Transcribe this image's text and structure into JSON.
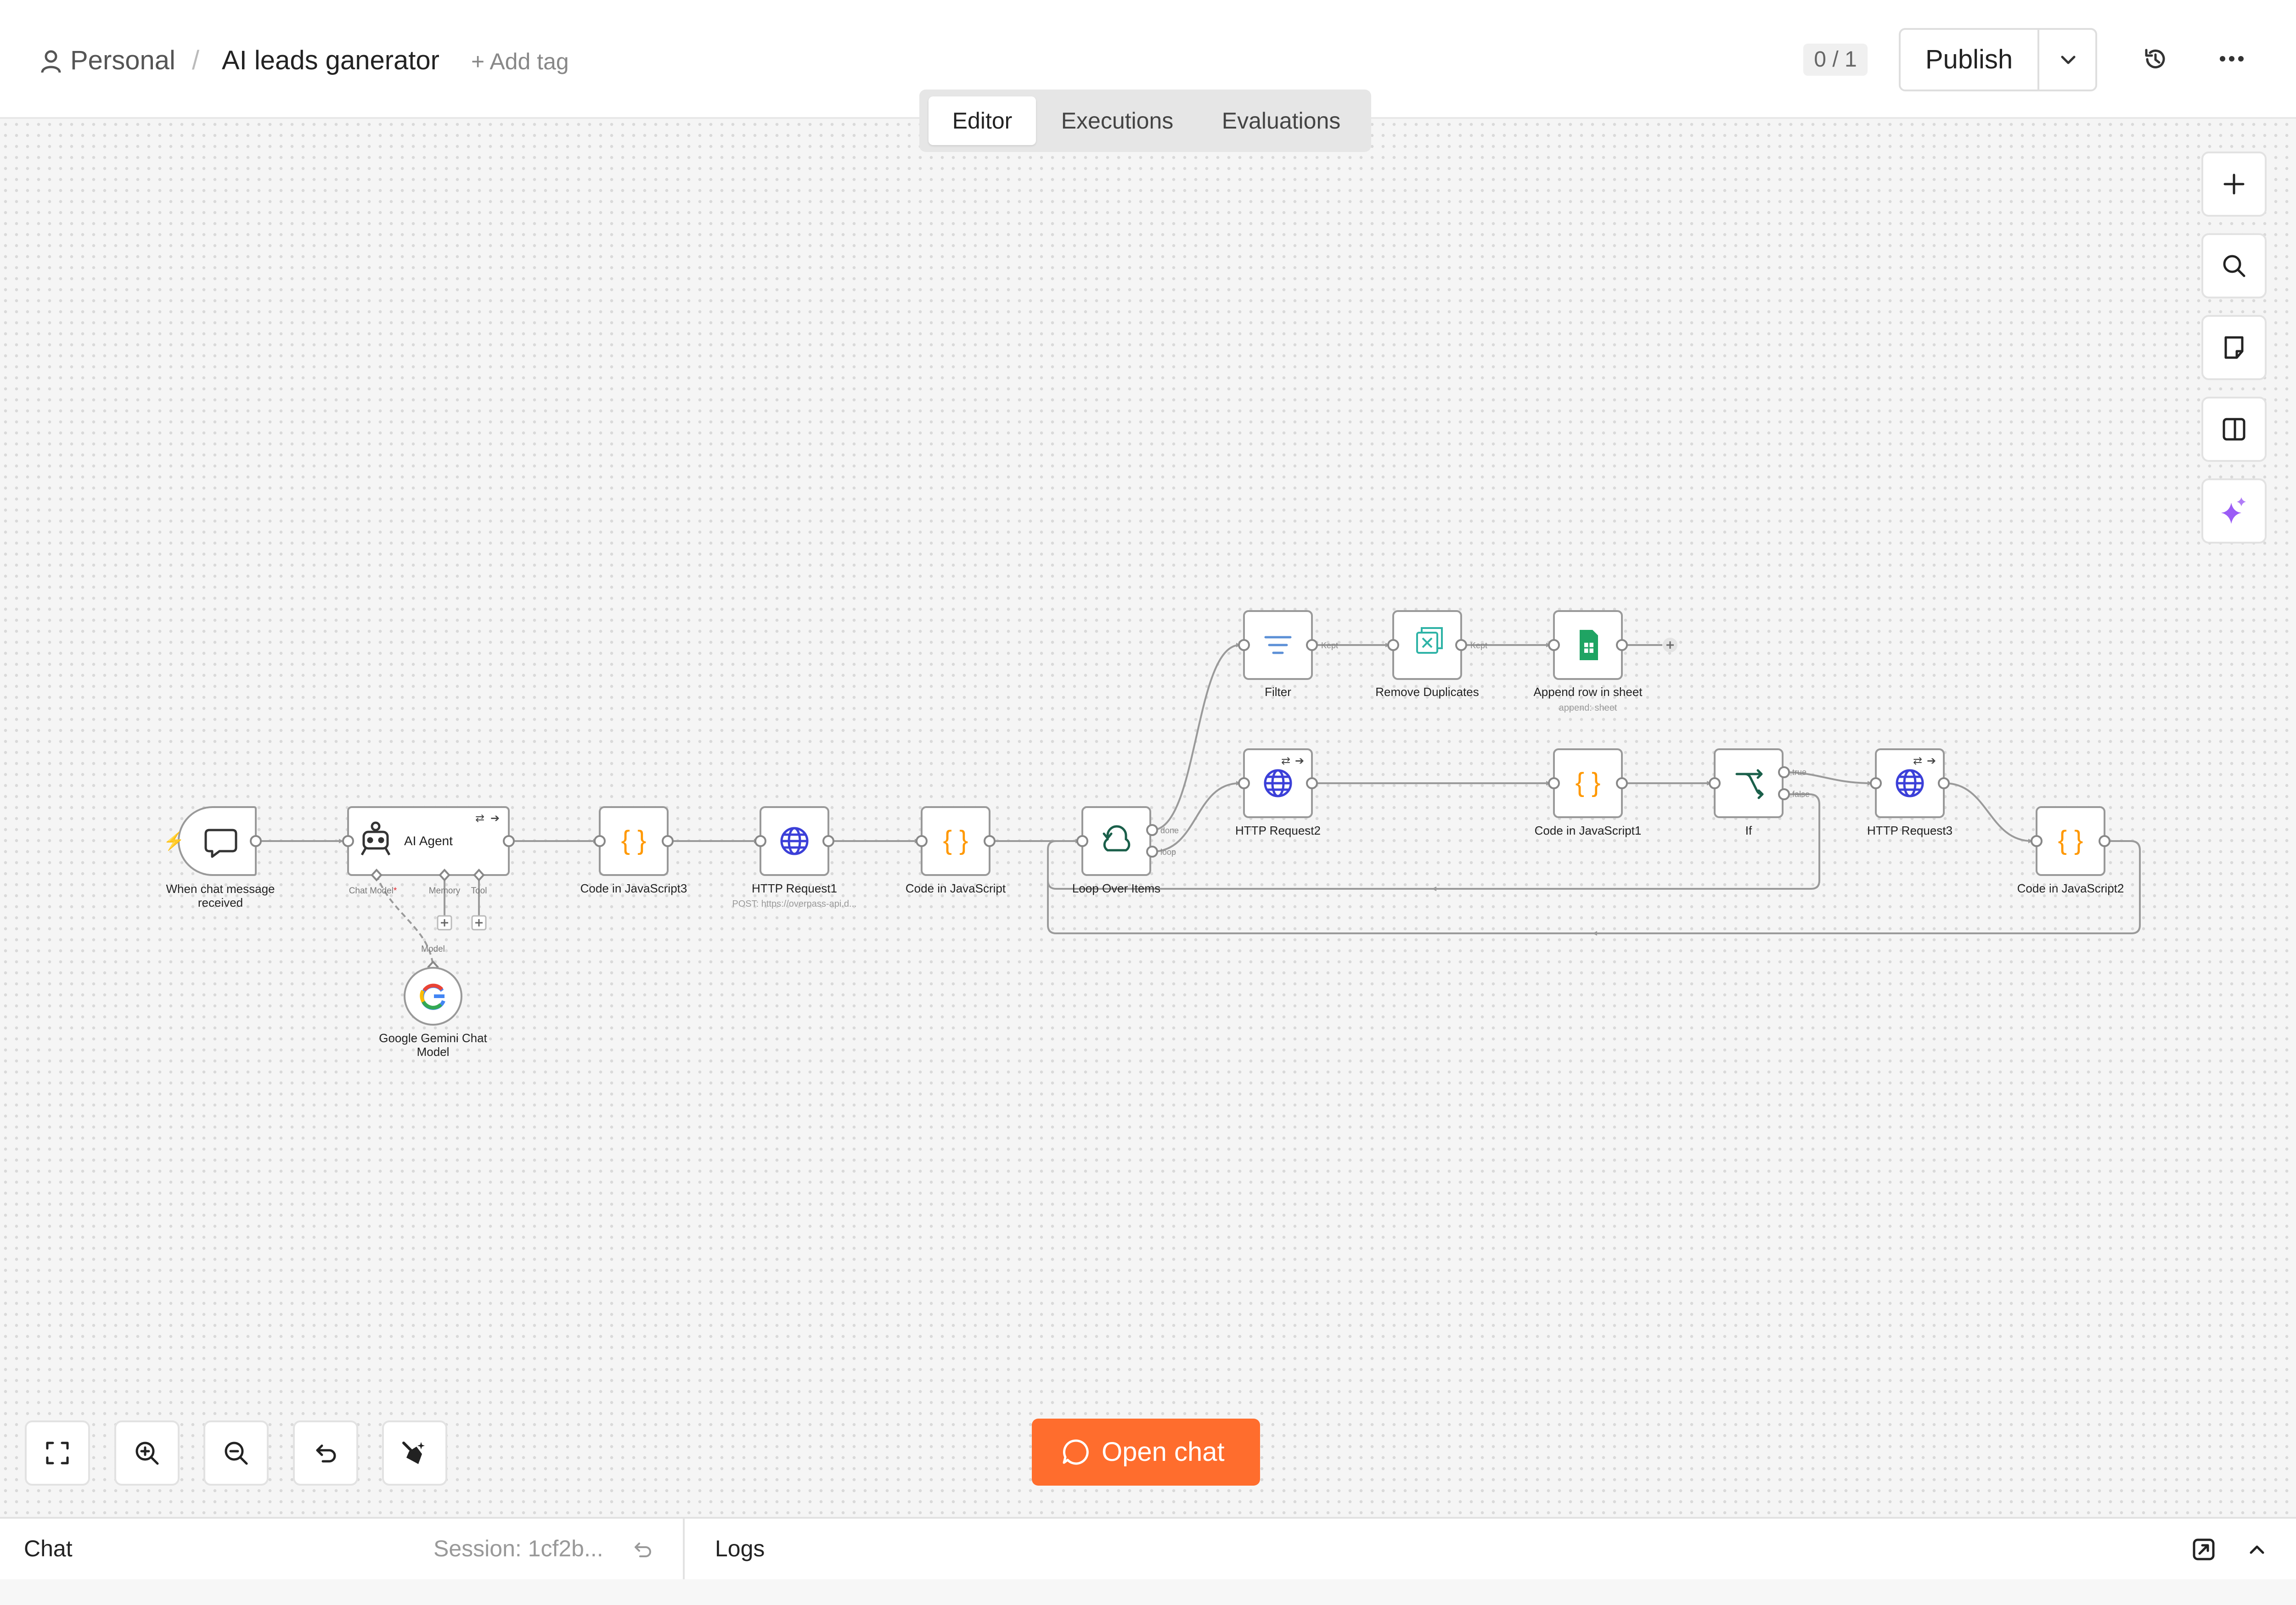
{
  "header": {
    "project": "Personal",
    "separator": "/",
    "workflow_name": "AI leads ganerator",
    "add_tag": "+ Add tag",
    "counter": "0 / 1",
    "publish": "Publish"
  },
  "tabs": [
    "Editor",
    "Executions",
    "Evaluations"
  ],
  "right_toolbar": [
    "plus-icon",
    "search-icon",
    "sticky-note-icon",
    "panel-icon",
    "sparkle-icon"
  ],
  "bottom_toolbar": [
    "fit-view-icon",
    "zoom-in-icon",
    "zoom-out-icon",
    "undo-icon",
    "clean-up-icon"
  ],
  "open_chat": "Open chat",
  "bottom_panel": {
    "chat": "Chat",
    "session": "Session: 1cf2b...",
    "logs": "Logs"
  },
  "nodes": {
    "trigger": "When chat message received",
    "agent": "AI Agent",
    "agent_inputs": [
      "Chat Model",
      "Memory",
      "Tool"
    ],
    "code3": "Code in JavaScript3",
    "http1": "HTTP Request1",
    "http1_sub": "POST: https://overpass-api.d...",
    "code": "Code in JavaScript",
    "loop": "Loop Over Items",
    "loop_outputs": [
      "done",
      "loop"
    ],
    "filter": "Filter",
    "remove_dup": "Remove Duplicates",
    "append": "Append row in sheet",
    "append_sub": "append: sheet",
    "kept": "Kept",
    "http2": "HTTP Request2",
    "code1": "Code in JavaScript1",
    "if": "If",
    "if_outputs": [
      "true",
      "false"
    ],
    "http3": "HTTP Request3",
    "code2": "Code in JavaScript2",
    "gemini": "Google Gemini Chat Model",
    "model_label": "Model"
  },
  "colors": {
    "accent": "#ff6d2d",
    "code": "#ff9800",
    "http": "#3b3fd8",
    "loop": "#1a5f4a",
    "sheet": "#1fa463",
    "filter": "#5b8fd6",
    "dedupe": "#2eb3a6",
    "sparkle": "#9b5cf6"
  }
}
